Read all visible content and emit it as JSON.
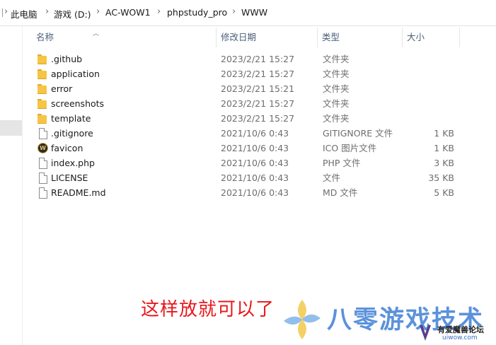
{
  "breadcrumb": [
    {
      "label": "此电脑"
    },
    {
      "label": "游戏 (D:)"
    },
    {
      "label": "AC-WOW1"
    },
    {
      "label": "phpstudy_pro"
    },
    {
      "label": "WWW"
    }
  ],
  "columns": {
    "name": "名称",
    "date": "修改日期",
    "type": "类型",
    "size": "大小"
  },
  "files": [
    {
      "name": ".github",
      "date": "2023/2/21 15:27",
      "type": "文件夹",
      "size": "",
      "icon": "folder-icon"
    },
    {
      "name": "application",
      "date": "2023/2/21 15:27",
      "type": "文件夹",
      "size": "",
      "icon": "folder-icon"
    },
    {
      "name": "error",
      "date": "2023/2/21 15:21",
      "type": "文件夹",
      "size": "",
      "icon": "folder-icon"
    },
    {
      "name": "screenshots",
      "date": "2023/2/21 15:27",
      "type": "文件夹",
      "size": "",
      "icon": "folder-icon"
    },
    {
      "name": "template",
      "date": "2023/2/21 15:27",
      "type": "文件夹",
      "size": "",
      "icon": "folder-icon"
    },
    {
      "name": ".gitignore",
      "date": "2021/10/6 0:43",
      "type": "GITIGNORE 文件",
      "size": "1 KB",
      "icon": "file-icon"
    },
    {
      "name": "favicon",
      "date": "2021/10/6 0:43",
      "type": "ICO 图片文件",
      "size": "1 KB",
      "icon": "wow-icon"
    },
    {
      "name": "index.php",
      "date": "2021/10/6 0:43",
      "type": "PHP 文件",
      "size": "3 KB",
      "icon": "file-icon"
    },
    {
      "name": "LICENSE",
      "date": "2021/10/6 0:43",
      "type": "文件",
      "size": "35 KB",
      "icon": "file-icon"
    },
    {
      "name": "README.md",
      "date": "2021/10/6 0:43",
      "type": "MD 文件",
      "size": "5 KB",
      "icon": "file-icon"
    }
  ],
  "annotation": "这样放就可以了",
  "watermark": {
    "title": "八零游戏技术",
    "subtitle": "有爱魔兽论坛",
    "url": "uiwow.com"
  },
  "colors": {
    "header_text": "#4c607a",
    "annotation": "#e8171b",
    "watermark_blue": "#4a87d8",
    "folder": "#f5c543"
  }
}
